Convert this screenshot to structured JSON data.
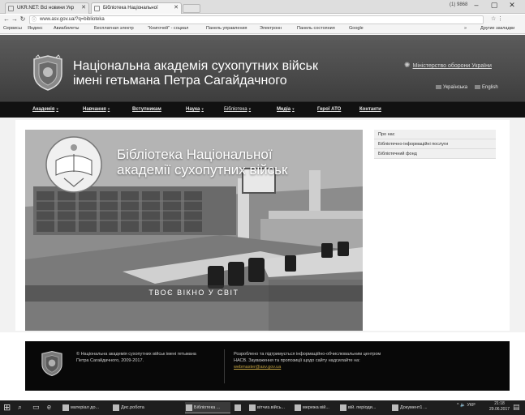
{
  "browser": {
    "tabs": [
      {
        "label": "UKR.NET: Всі новини Укр"
      },
      {
        "label": "Бібліотека Національної"
      }
    ],
    "window_user": "(1) 9868",
    "url": "www.asv.gov.ua/?q=biblioteka",
    "bookmarks": [
      "Сервисы",
      "Яндекс",
      "Авиабилеты",
      "Бесплатная электр",
      "\"Книгочей\" - социал",
      "Панель управления",
      "Электронн",
      "Панель состояния",
      "Google",
      "»",
      "Другие закладки"
    ]
  },
  "site": {
    "title_line1": "Національна академія сухопутних військ",
    "title_line2": "імені гетьмана Петра Сагайдачного",
    "ministry_link": "Міністерство оборони України",
    "lang_ua": "Українська",
    "lang_en": "English",
    "nav": [
      "Академія",
      "Навчання",
      "Вступникам",
      "Наука",
      "Бібліотека",
      "Медіа",
      "Герої АТО",
      "Контакти"
    ],
    "banner_title_line1": "Бібліотека Національної",
    "banner_title_line2": "академії сухопутних військ",
    "banner_slogan": "ТВОЄ ВІКНО У СВІТ",
    "side_menu": [
      "Про нас",
      "Бібліотечно-інформаційні послуги",
      "Бібліотечний фонд"
    ],
    "footer_left": "© Національна академія сухопутних військ імені гетьмана Петра Сагайдачного, 2009-2017.",
    "footer_right": "Розроблено та підтримується інформаційно-обчислювальним центром НАСВ. Зауваження та пропозиції щодо сайту надсилайте на:",
    "footer_email": "webmaster@asv.gov.ua"
  },
  "taskbar": {
    "apps": [
      "матеріал до...",
      "Дис.робота",
      "Бібліотека ...",
      "",
      "вітчиз.війсь...",
      "мережа вій...",
      "вій. періоди...",
      "Документ1 ..."
    ],
    "tray": "^ 🔈 УКР",
    "time": "21:18",
    "date": "29.06.2017"
  },
  "colors": {
    "header_bg": "#4a4a4a",
    "nav_bg": "#111111",
    "footer_bg": "#080808",
    "email_link": "#c0a040"
  }
}
